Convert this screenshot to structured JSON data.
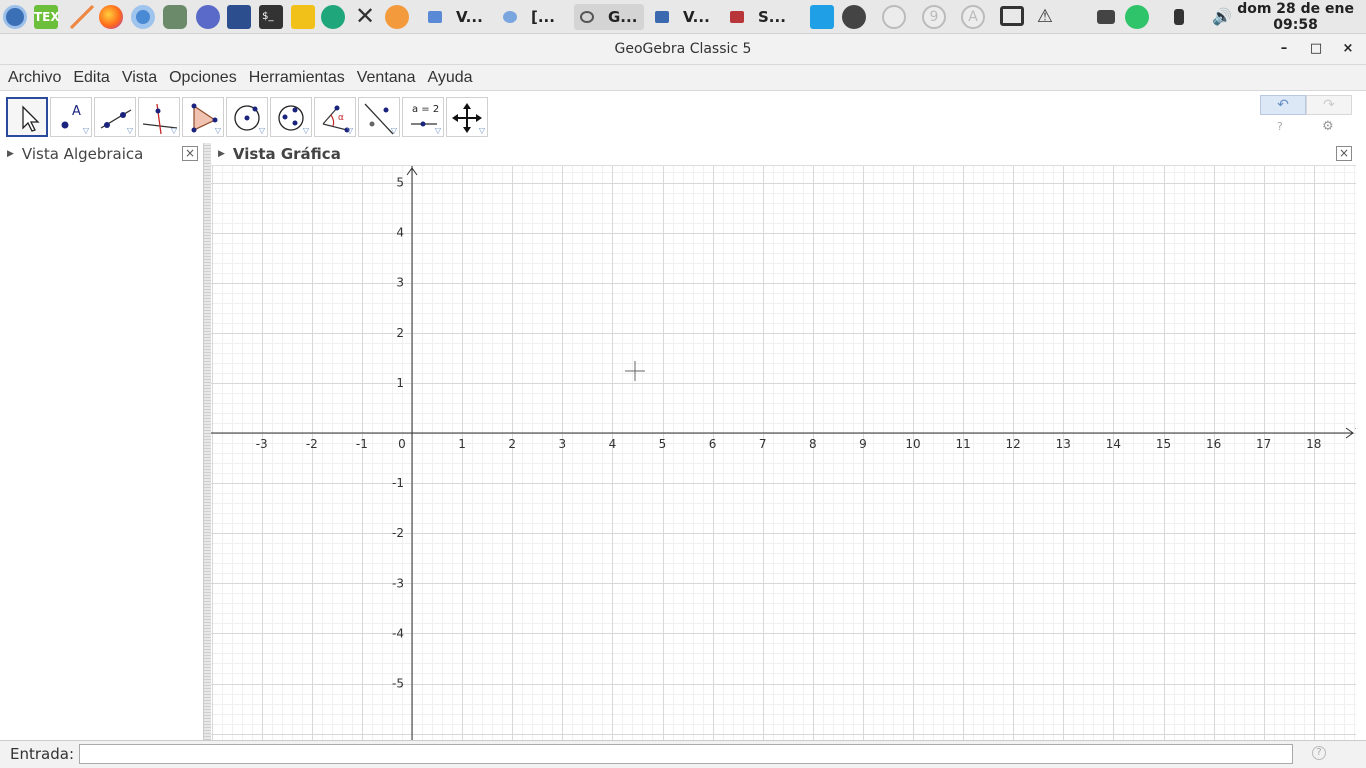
{
  "taskbar": {
    "windows": [
      {
        "label": "V...",
        "icon": "folder-icon"
      },
      {
        "label": "[...",
        "icon": "browser-icon"
      },
      {
        "label": "G...",
        "icon": "geogebra-icon"
      },
      {
        "label": "V...",
        "icon": "folder-icon"
      },
      {
        "label": "S...",
        "icon": "presentation-icon"
      }
    ],
    "clock_date": "dom 28 de ene",
    "clock_time": "09:58"
  },
  "window": {
    "title": "GeoGebra Classic 5",
    "minimize": "–",
    "maximize": "□",
    "close": "×"
  },
  "menu": [
    "Archivo",
    "Edita",
    "Vista",
    "Opciones",
    "Herramientas",
    "Ventana",
    "Ayuda"
  ],
  "toolbar": {
    "tools": [
      "move-tool-icon",
      "point-tool-icon",
      "line-tool-icon",
      "perpendicular-tool-icon",
      "polygon-tool-icon",
      "circle-tool-icon",
      "conic-tool-icon",
      "angle-tool-icon",
      "reflect-tool-icon",
      "slider-tool-icon",
      "move-view-tool-icon"
    ],
    "slider_label": "a = 2",
    "undo": "↶",
    "redo": "↷",
    "help": "?",
    "settings": "⚙"
  },
  "algebra_view": {
    "title": "Vista Algebraica",
    "close": "×"
  },
  "graphics_view": {
    "title": "Vista Gráfica",
    "close": "×",
    "x_ticks": [
      "-3",
      "-2",
      "-1",
      "0",
      "1",
      "2",
      "3",
      "4",
      "5",
      "6",
      "7",
      "8",
      "9",
      "10",
      "11",
      "12",
      "13",
      "14",
      "15",
      "16",
      "17",
      "18"
    ],
    "y_ticks_positive": [
      "5",
      "4",
      "3",
      "2",
      "1"
    ],
    "y_ticks_negative": [
      "-1",
      "-2",
      "-3",
      "-4",
      "-5"
    ]
  },
  "input_bar": {
    "label": "Entrada:",
    "value": "",
    "help": "?"
  }
}
